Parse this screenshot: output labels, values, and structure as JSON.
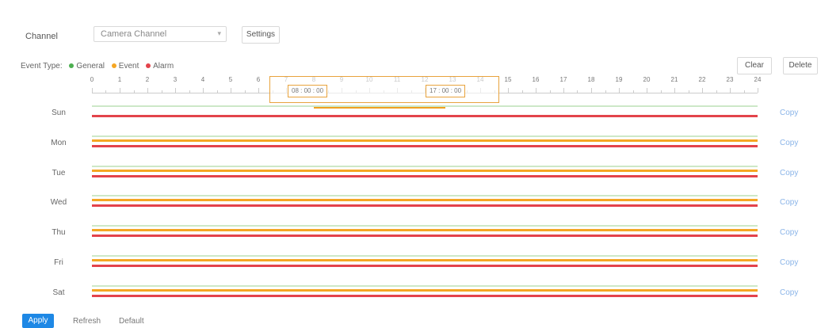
{
  "header": {
    "caption": ""
  },
  "channel": {
    "label": "Channel",
    "value": "Camera Channel",
    "setting_label": "Settings"
  },
  "legend": {
    "prefix": "Event Type:",
    "items": [
      {
        "label": "General",
        "color": "#4caf50"
      },
      {
        "label": "Event",
        "color": "#f5a623"
      },
      {
        "label": "Alarm",
        "color": "#e3434b"
      }
    ]
  },
  "actions": {
    "clear": "Clear",
    "delete": "Delete"
  },
  "timeline": {
    "ticks": [
      "0",
      "1",
      "2",
      "3",
      "4",
      "5",
      "6",
      "7",
      "8",
      "9",
      "10",
      "11",
      "12",
      "13",
      "14",
      "15",
      "16",
      "17",
      "18",
      "19",
      "20",
      "21",
      "22",
      "23",
      "24"
    ],
    "selection": {
      "start": "08 : 00 : 00",
      "end": "17 : 00 : 00"
    }
  },
  "days": [
    {
      "label": "Sun",
      "copy": "Copy",
      "has_orange": false
    },
    {
      "label": "Mon",
      "copy": "Copy",
      "has_orange": true
    },
    {
      "label": "Tue",
      "copy": "Copy",
      "has_orange": true
    },
    {
      "label": "Wed",
      "copy": "Copy",
      "has_orange": true
    },
    {
      "label": "Thu",
      "copy": "Copy",
      "has_orange": true
    },
    {
      "label": "Fri",
      "copy": "Copy",
      "has_orange": true
    },
    {
      "label": "Sat",
      "copy": "Copy",
      "has_orange": true
    }
  ],
  "footer": {
    "apply": "Apply",
    "refresh": "Refresh",
    "default": "Default"
  }
}
